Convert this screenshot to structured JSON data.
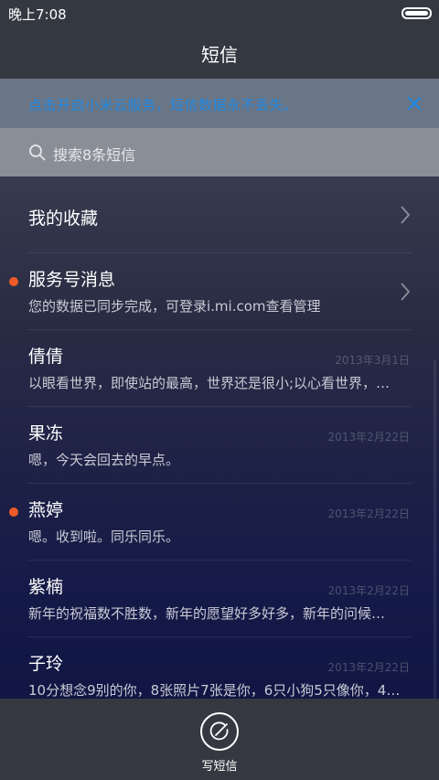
{
  "statusbar": {
    "time": "晚上7:08"
  },
  "header": {
    "title": "短信"
  },
  "banner": {
    "text": "点击开启小米云服务，短信数据永不丢失。"
  },
  "search": {
    "placeholder": "搜索8条短信"
  },
  "list": {
    "favorites": {
      "name": "我的收藏"
    },
    "items": [
      {
        "name": "服务号消息",
        "preview": "您的数据已同步完成，可登录i.mi.com查看管理",
        "date": "",
        "unread": true
      },
      {
        "name": "倩倩",
        "preview": "以眼看世界，即使站的最高，世界还是很小;以心看世界，…",
        "date": "2013年3月1日",
        "unread": false
      },
      {
        "name": "果冻",
        "preview": "嗯，今天会回去的早点。",
        "date": "2013年2月22日",
        "unread": false
      },
      {
        "name": "燕婷",
        "preview": "嗯。收到啦。同乐同乐。",
        "date": "2013年2月22日",
        "unread": true
      },
      {
        "name": "紫楠",
        "preview": "新年的祝福数不胜数，新年的愿望好多好多，新年的问候…",
        "date": "2013年2月22日",
        "unread": false
      },
      {
        "name": "子玲",
        "preview": "10分想念9别的你，8张照片7张是你，6只小狗5只像你，4…",
        "date": "2013年2月22日",
        "unread": false
      }
    ]
  },
  "bottom": {
    "compose_label": "写短信"
  },
  "icons": {
    "search": "search-icon",
    "close": "close-icon",
    "chevron": "chevron-right-icon",
    "compose": "compose-icon",
    "battery": "battery-icon"
  },
  "colors": {
    "unread_dot": "#f05a28",
    "banner_text": "#1e88e5"
  }
}
